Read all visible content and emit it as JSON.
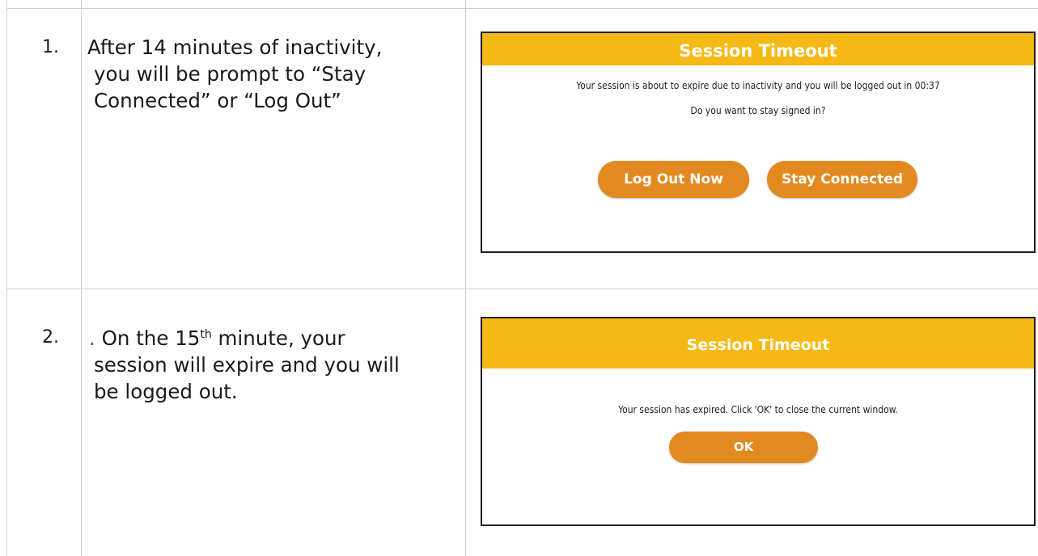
{
  "steps": [
    {
      "number": "1.",
      "text_lines": [
        "After 14 minutes of inactivity,",
        "you will be prompt to “Stay",
        "Connected” or “Log Out”"
      ]
    },
    {
      "number": "2.",
      "lead_mark": ".",
      "text_pre": "On the 15",
      "text_sup": "th",
      "text_post": " minute, your",
      "text_lines": [
        "session will expire and you will",
        "be logged out."
      ]
    }
  ],
  "dialogs": [
    {
      "title": "Session Timeout",
      "message": "Your session is about to expire due to inactivity and you will be logged out in 00:37",
      "question": "Do you want to stay signed in?",
      "buttons": [
        "Log Out Now",
        "Stay Connected"
      ]
    },
    {
      "title": "Session Timeout",
      "message": "Your session has expired. Click 'OK' to close the current window.",
      "buttons": [
        "OK"
      ]
    }
  ],
  "colors": {
    "header": "#f6b814",
    "button": "#e28a1f",
    "grid": "#cfcfcf"
  }
}
